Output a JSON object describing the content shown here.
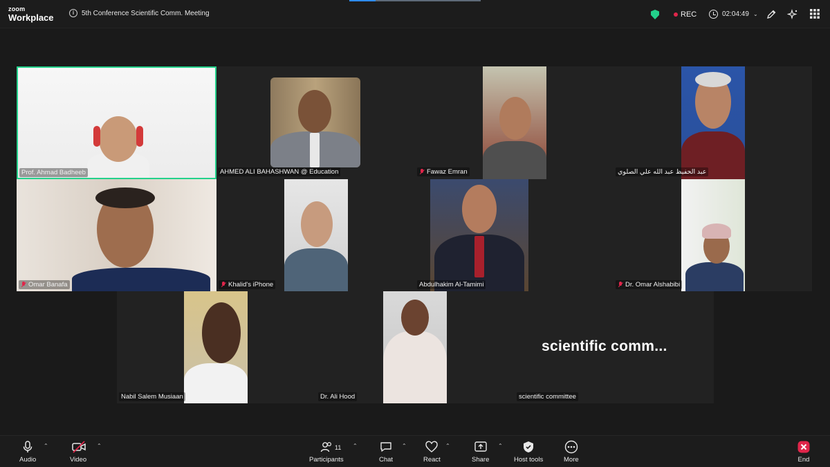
{
  "app": {
    "logo_line1": "zoom",
    "logo_line2": "Workplace"
  },
  "meeting": {
    "title": "5th Conference Scientific Comm. Meeting",
    "rec_label": "REC",
    "elapsed": "02:04:49"
  },
  "participants": [
    {
      "name": "Prof. Ahmad Badheeb",
      "muted": false,
      "active": true
    },
    {
      "name": "AHMED ALI BAHASHWAN @ Education",
      "muted": false
    },
    {
      "name": "Fawaz Emran",
      "muted": true
    },
    {
      "name": "عبد الحفيظ عبد الله علي الصلوي",
      "muted": false
    },
    {
      "name": "Omar Banafa",
      "muted": true
    },
    {
      "name": "Khalid's iPhone",
      "muted": true
    },
    {
      "name": "Abdulhakim Al-Tamimi",
      "muted": false
    },
    {
      "name": "Dr. Omar Alshabibi",
      "muted": true
    },
    {
      "name": "Nabil Salem Musiaan",
      "muted": false
    },
    {
      "name": "Dr. Ali Hood",
      "muted": false
    },
    {
      "name": "scientific committee",
      "muted": false,
      "video_off_label": "scientific  comm..."
    }
  ],
  "toolbar": {
    "audio": "Audio",
    "video": "Video",
    "participants": "Participants",
    "participants_count": "11",
    "chat": "Chat",
    "react": "React",
    "share": "Share",
    "host_tools": "Host tools",
    "more": "More",
    "end": "End"
  },
  "colors": {
    "active_speaker": "#23d18b",
    "rec_dot": "#e0254a",
    "end_button": "#e0254a",
    "background": "#1a1a1a"
  }
}
